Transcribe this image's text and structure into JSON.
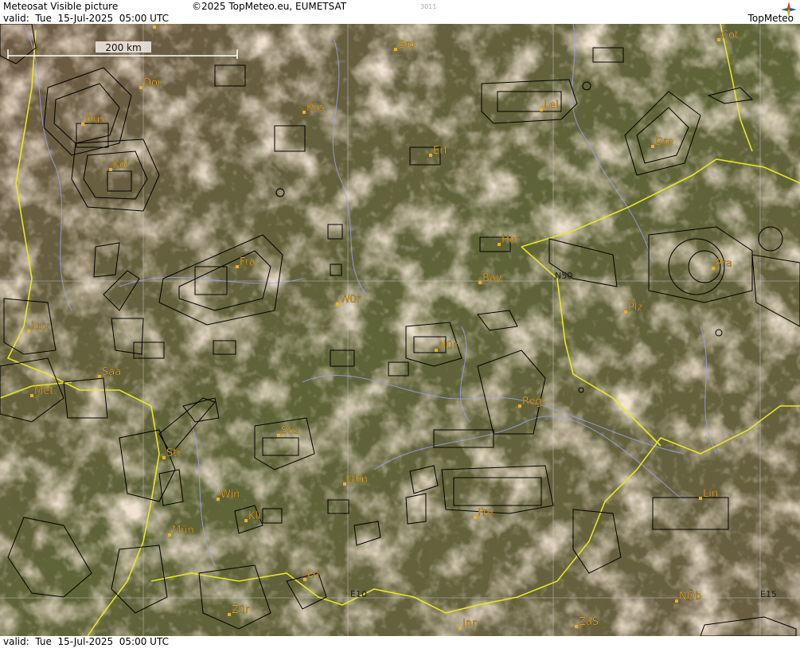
{
  "header": {
    "product_title": "Meteosat Visible picture",
    "copyright": "©2025 TopMeteo.eu, EUMETSAT",
    "code": "3011",
    "valid": "valid:  Tue  15-Jul-2025  05:00 UTC"
  },
  "footer": {
    "valid": "valid:  Tue  15-Jul-2025  05:00 UTC"
  },
  "logo": {
    "text": "TopMeteo",
    "icon": "compass-rose-icon"
  },
  "scale_bar": {
    "label": "200 km"
  },
  "grid_labels": [
    "N50",
    "E10",
    "E15"
  ],
  "cities": [
    {
      "label": "Mün"
    },
    {
      "label": "Bro"
    },
    {
      "label": "Cot"
    },
    {
      "label": "Dor"
    },
    {
      "label": "Kas"
    },
    {
      "label": "Lei"
    },
    {
      "label": "Düs"
    },
    {
      "label": "Erf"
    },
    {
      "label": "Dre"
    },
    {
      "label": "Köl"
    },
    {
      "label": "Hof"
    },
    {
      "label": "Fra"
    },
    {
      "label": "Pra"
    },
    {
      "label": "Bay"
    },
    {
      "label": "Wür"
    },
    {
      "label": "Plz"
    },
    {
      "label": "Lux"
    },
    {
      "label": "Nür"
    },
    {
      "label": "Saa"
    },
    {
      "label": "Met"
    },
    {
      "label": "Reg"
    },
    {
      "label": "Stu"
    },
    {
      "label": "Str"
    },
    {
      "label": "Ulm"
    },
    {
      "label": "Win"
    },
    {
      "label": "Lin"
    },
    {
      "label": "Kli"
    },
    {
      "label": "Mün"
    },
    {
      "label": "Fre"
    },
    {
      "label": "Fri"
    },
    {
      "label": "NÖb"
    },
    {
      "label": "Zür"
    },
    {
      "label": "Inn"
    },
    {
      "label": "ZaS"
    }
  ],
  "colors": {
    "label": "#f0b020",
    "border": "#e8e820",
    "river": "#9aa0f0",
    "airspace": "#000000"
  }
}
